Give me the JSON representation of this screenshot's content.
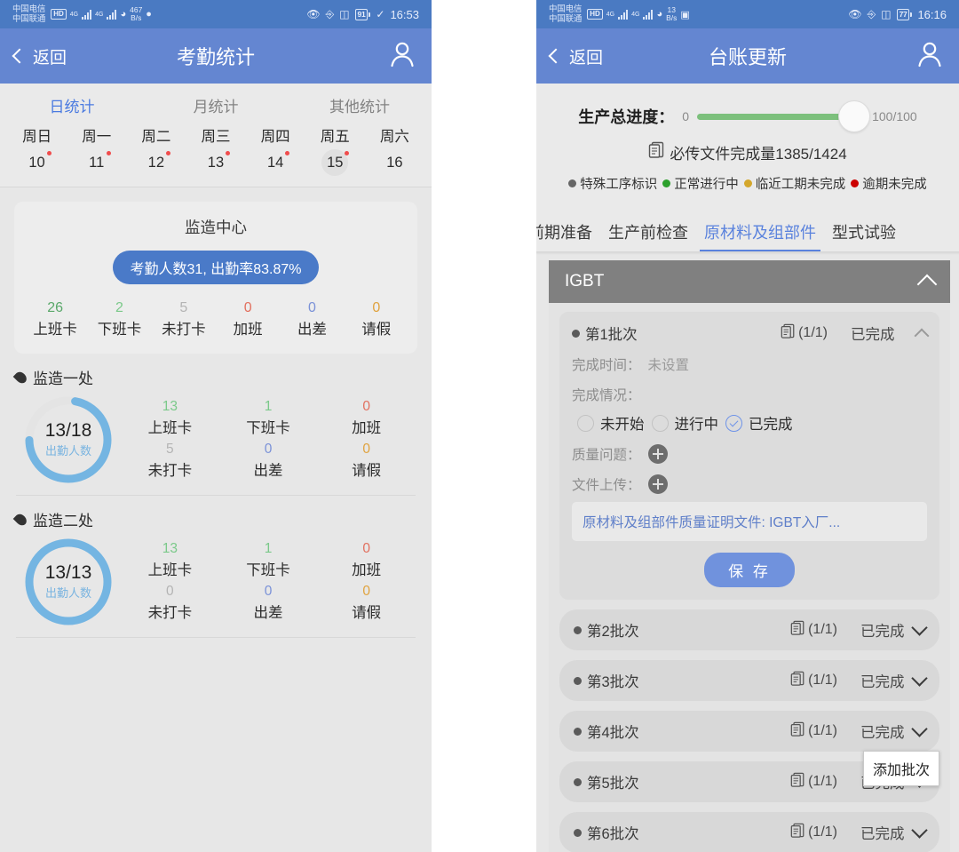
{
  "left": {
    "statusbar": {
      "carrier1": "中国电信",
      "carrier2": "中国联通",
      "hd": "HD",
      "net_speed_num": "467",
      "net_speed_unit": "B/s",
      "battery": "91",
      "clock": "16:53"
    },
    "nav": {
      "back": "返回",
      "title": "考勤统计"
    },
    "segments": [
      {
        "label": "日统计",
        "active": true
      },
      {
        "label": "月统计",
        "active": false
      },
      {
        "label": "其他统计",
        "active": false
      }
    ],
    "week": [
      {
        "name": "周日",
        "num": "10",
        "dot": true,
        "selected": false
      },
      {
        "name": "周一",
        "num": "11",
        "dot": true,
        "selected": false
      },
      {
        "name": "周二",
        "num": "12",
        "dot": true,
        "selected": false
      },
      {
        "name": "周三",
        "num": "13",
        "dot": true,
        "selected": false
      },
      {
        "name": "周四",
        "num": "14",
        "dot": true,
        "selected": false
      },
      {
        "name": "周五",
        "num": "15",
        "dot": true,
        "selected": true
      },
      {
        "name": "周六",
        "num": "16",
        "dot": false,
        "selected": false
      }
    ],
    "summary": {
      "title": "监造中心",
      "pill": "考勤人数31, 出勤率83.87%",
      "kpis": [
        {
          "value": "26",
          "label": "上班卡",
          "color": "#5aa86a"
        },
        {
          "value": "2",
          "label": "下班卡",
          "color": "#7bc98a"
        },
        {
          "value": "5",
          "label": "未打卡",
          "color": "#b4b4b4"
        },
        {
          "value": "0",
          "label": "加班",
          "color": "#e2705f"
        },
        {
          "value": "0",
          "label": "出差",
          "color": "#7b92d8"
        },
        {
          "value": "0",
          "label": "请假",
          "color": "#e0a33f"
        }
      ]
    },
    "departments": [
      {
        "name": "监造一处",
        "ring_main": "13/18",
        "ring_sub": "出勤人数",
        "ring_pct": 72,
        "cells": [
          {
            "value": "13",
            "label": "上班卡",
            "color": "#7bc98a"
          },
          {
            "value": "1",
            "label": "下班卡",
            "color": "#7bc98a"
          },
          {
            "value": "0",
            "label": "加班",
            "color": "#e2705f"
          },
          {
            "value": "5",
            "label": "未打卡",
            "color": "#b4b4b4"
          },
          {
            "value": "0",
            "label": "出差",
            "color": "#7b92d8"
          },
          {
            "value": "0",
            "label": "请假",
            "color": "#e0a33f"
          }
        ]
      },
      {
        "name": "监造二处",
        "ring_main": "13/13",
        "ring_sub": "出勤人数",
        "ring_pct": 100,
        "cells": [
          {
            "value": "13",
            "label": "上班卡",
            "color": "#7bc98a"
          },
          {
            "value": "1",
            "label": "下班卡",
            "color": "#7bc98a"
          },
          {
            "value": "0",
            "label": "加班",
            "color": "#e2705f"
          },
          {
            "value": "0",
            "label": "未打卡",
            "color": "#b4b4b4"
          },
          {
            "value": "0",
            "label": "出差",
            "color": "#7b92d8"
          },
          {
            "value": "0",
            "label": "请假",
            "color": "#e0a33f"
          }
        ]
      }
    ]
  },
  "right": {
    "statusbar": {
      "carrier1": "中国电信",
      "carrier2": "中国联通",
      "hd": "HD",
      "net_speed_num": "13",
      "net_speed_unit": "B/s",
      "battery": "77",
      "clock": "16:16"
    },
    "nav": {
      "back": "返回",
      "title": "台账更新"
    },
    "progress": {
      "label": "生产总进度：",
      "min": "0",
      "max": "100/100",
      "value": 100,
      "bar_color": "#7cc07c",
      "files_text": "必传文件完成量1385/1424"
    },
    "legend": [
      {
        "label": "特殊工序标识",
        "color": "#666666"
      },
      {
        "label": "正常进行中",
        "color": "#2ca02c"
      },
      {
        "label": "临近工期未完成",
        "color": "#d4a72c"
      },
      {
        "label": "逾期未完成",
        "color": "#cc0000"
      }
    ],
    "tabs": [
      {
        "label": "前期准备",
        "active": false
      },
      {
        "label": "生产前检查",
        "active": false
      },
      {
        "label": "原材料及组部件",
        "active": true
      },
      {
        "label": "型式试验",
        "active": false
      }
    ],
    "group": {
      "title": "IGBT"
    },
    "batch_open": {
      "name": "第1批次",
      "docs": "(1/1)",
      "status": "已完成",
      "finish_time_label": "完成时间：",
      "finish_time_value": "未设置",
      "status_label": "完成情况：",
      "options": [
        {
          "label": "未开始",
          "checked": false
        },
        {
          "label": "进行中",
          "checked": false
        },
        {
          "label": "已完成",
          "checked": true
        }
      ],
      "quality_label": "质量问题：",
      "upload_label": "文件上传：",
      "file_name": "原材料及组部件质量证明文件: IGBT入厂...",
      "save_label": "保 存"
    },
    "batches_closed": [
      {
        "name": "第2批次",
        "docs": "(1/1)",
        "status": "已完成"
      },
      {
        "name": "第3批次",
        "docs": "(1/1)",
        "status": "已完成"
      },
      {
        "name": "第4批次",
        "docs": "(1/1)",
        "status": "已完成"
      },
      {
        "name": "第5批次",
        "docs": "(1/1)",
        "status": "已完成"
      },
      {
        "name": "第6批次",
        "docs": "(1/1)",
        "status": "已完成"
      }
    ],
    "tooltip": "添加批次"
  }
}
